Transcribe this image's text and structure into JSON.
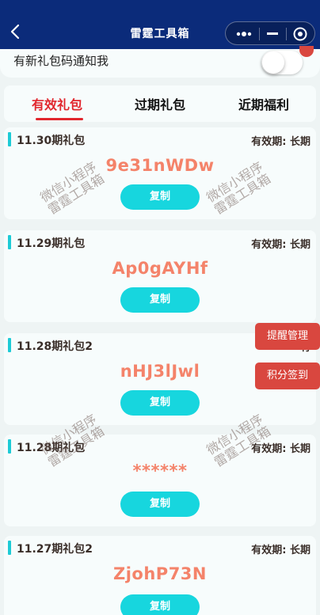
{
  "navbar": {
    "title": "雷霆工具箱",
    "back_icon": "chevron-left-icon",
    "more_icon": "more-dots-icon",
    "minimize_icon": "minimize-icon",
    "close_icon": "close-circle-icon",
    "background": "#0b2b7a"
  },
  "notify": {
    "label": "有新礼包码通知我",
    "toggle_on": false
  },
  "tabs": [
    {
      "label": "有效礼包",
      "active": true
    },
    {
      "label": "过期礼包",
      "active": false
    },
    {
      "label": "近期福利",
      "active": false
    }
  ],
  "cards": [
    {
      "title": "11.30期礼包",
      "valid": "有效期: 长期",
      "code": "9e31nWDw",
      "copy": "复制"
    },
    {
      "title": "11.29期礼包",
      "valid": "有效期: 长期",
      "code": "Ap0gAYHf",
      "copy": "复制"
    },
    {
      "title": "11.28期礼包2",
      "valid": "有",
      "code": "nHJ3lJwl",
      "copy": "复制"
    },
    {
      "title": "11.28期礼包",
      "valid": "有效期: 长期",
      "code": "******",
      "copy": "复制"
    },
    {
      "title": "11.27期礼包2",
      "valid": "有效期: 长期",
      "code": "ZjohP73N",
      "copy": "复制"
    }
  ],
  "watermark": {
    "line1": "微信小程序",
    "line2": "雷霆工具箱"
  },
  "side_buttons": {
    "reminder": "提醒管理",
    "checkin": "积分签到"
  },
  "colors": {
    "accent_red": "#e1262d",
    "code_orange": "#f4836a",
    "copy_cyan": "#17d6de",
    "side_red": "#d9473f"
  }
}
